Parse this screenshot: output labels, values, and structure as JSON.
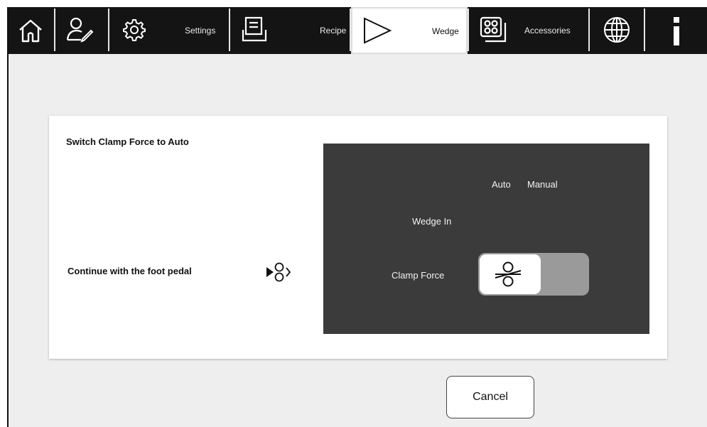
{
  "toolbar": {
    "items": [
      {
        "id": "home",
        "icon": "home-icon",
        "label": ""
      },
      {
        "id": "operator",
        "icon": "user-edit-icon",
        "label": ""
      },
      {
        "id": "settings",
        "icon": "gear-icon",
        "label": "Settings"
      },
      {
        "id": "recipe",
        "icon": "recipe-icon",
        "label": "Recipe"
      },
      {
        "id": "wedge",
        "icon": "wedge-play-icon",
        "label": "Wedge",
        "active": true
      },
      {
        "id": "accessories",
        "icon": "accessories-icon",
        "label": "Accessories"
      },
      {
        "id": "language",
        "icon": "globe-icon",
        "label": ""
      },
      {
        "id": "info",
        "icon": "info-icon",
        "label": ""
      }
    ]
  },
  "dialog": {
    "instruction_title": "Switch Clamp Force to Auto",
    "instruction_continue": "Continue with the foot pedal",
    "pedal_icon": "foot-pedal-icon",
    "panel": {
      "auto_label": "Auto",
      "manual_label": "Manual",
      "wedge_in_label": "Wedge In",
      "clamp_force_label": "Clamp Force",
      "clamp_force_state": "Auto",
      "clamp_icon": "clamp-rollers-icon"
    },
    "cancel_label": "Cancel"
  },
  "colors": {
    "toolbar_bg": "#141414",
    "screen_bg": "#eeeeee",
    "panel_bg": "#3b3b3b",
    "toggle_track": "#9a9a9a"
  }
}
